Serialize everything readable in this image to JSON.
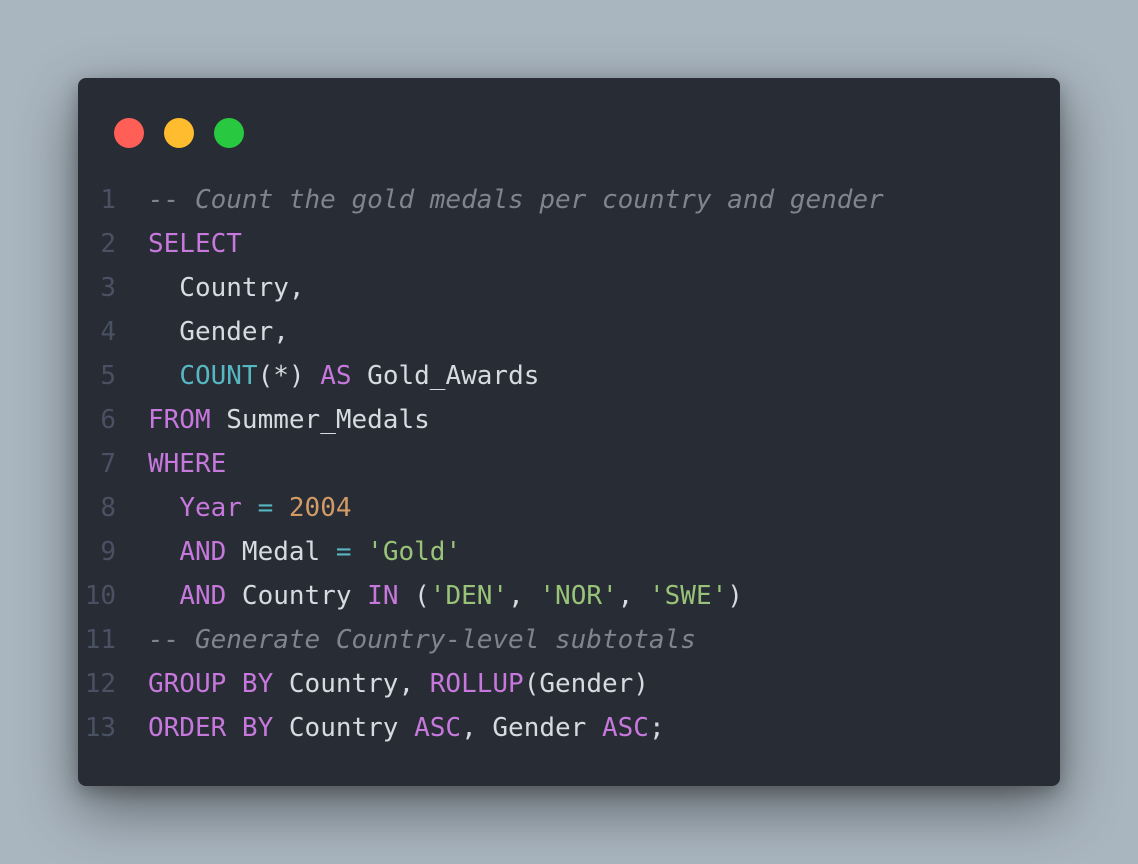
{
  "colors": {
    "background": "#a9b5bf",
    "window": "#282c34",
    "close": "#ff5f57",
    "minimize": "#febc2e",
    "maximize": "#28c840"
  },
  "window_controls": [
    {
      "name": "close-button",
      "color": "#ff5f57"
    },
    {
      "name": "minimize-button",
      "color": "#febc2e"
    },
    {
      "name": "maximize-button",
      "color": "#28c840"
    }
  ],
  "code_lines": [
    {
      "number": "1",
      "tokens": [
        [
          "comment",
          "-- Count the gold medals per country and gender"
        ]
      ]
    },
    {
      "number": "2",
      "tokens": [
        [
          "keyword",
          "SELECT"
        ]
      ]
    },
    {
      "number": "3",
      "tokens": [
        [
          "plain",
          "  Country,"
        ]
      ]
    },
    {
      "number": "4",
      "tokens": [
        [
          "plain",
          "  Gender,"
        ]
      ]
    },
    {
      "number": "5",
      "tokens": [
        [
          "plain",
          "  "
        ],
        [
          "function",
          "COUNT"
        ],
        [
          "plain",
          "(*) "
        ],
        [
          "keyword",
          "AS"
        ],
        [
          "plain",
          " Gold_Awards"
        ]
      ]
    },
    {
      "number": "6",
      "tokens": [
        [
          "keyword",
          "FROM"
        ],
        [
          "plain",
          " Summer_Medals"
        ]
      ]
    },
    {
      "number": "7",
      "tokens": [
        [
          "keyword",
          "WHERE"
        ]
      ]
    },
    {
      "number": "8",
      "tokens": [
        [
          "plain",
          "  "
        ],
        [
          "keyword",
          "Year"
        ],
        [
          "plain",
          " "
        ],
        [
          "operator",
          "="
        ],
        [
          "plain",
          " "
        ],
        [
          "number",
          "2004"
        ]
      ]
    },
    {
      "number": "9",
      "tokens": [
        [
          "plain",
          "  "
        ],
        [
          "keyword",
          "AND"
        ],
        [
          "plain",
          " Medal "
        ],
        [
          "operator",
          "="
        ],
        [
          "plain",
          " "
        ],
        [
          "string",
          "'Gold'"
        ]
      ]
    },
    {
      "number": "10",
      "tokens": [
        [
          "plain",
          "  "
        ],
        [
          "keyword",
          "AND"
        ],
        [
          "plain",
          " Country "
        ],
        [
          "keyword",
          "IN"
        ],
        [
          "plain",
          " ("
        ],
        [
          "string",
          "'DEN'"
        ],
        [
          "plain",
          ", "
        ],
        [
          "string",
          "'NOR'"
        ],
        [
          "plain",
          ", "
        ],
        [
          "string",
          "'SWE'"
        ],
        [
          "plain",
          ")"
        ]
      ]
    },
    {
      "number": "11",
      "tokens": [
        [
          "comment",
          "-- Generate Country-level subtotals"
        ]
      ]
    },
    {
      "number": "12",
      "tokens": [
        [
          "keyword",
          "GROUP BY"
        ],
        [
          "plain",
          " Country, "
        ],
        [
          "keyword",
          "ROLLUP"
        ],
        [
          "plain",
          "(Gender)"
        ]
      ]
    },
    {
      "number": "13",
      "tokens": [
        [
          "keyword",
          "ORDER BY"
        ],
        [
          "plain",
          " Country "
        ],
        [
          "keyword",
          "ASC"
        ],
        [
          "plain",
          ", Gender "
        ],
        [
          "keyword",
          "ASC"
        ],
        [
          "plain",
          ";"
        ]
      ]
    }
  ]
}
